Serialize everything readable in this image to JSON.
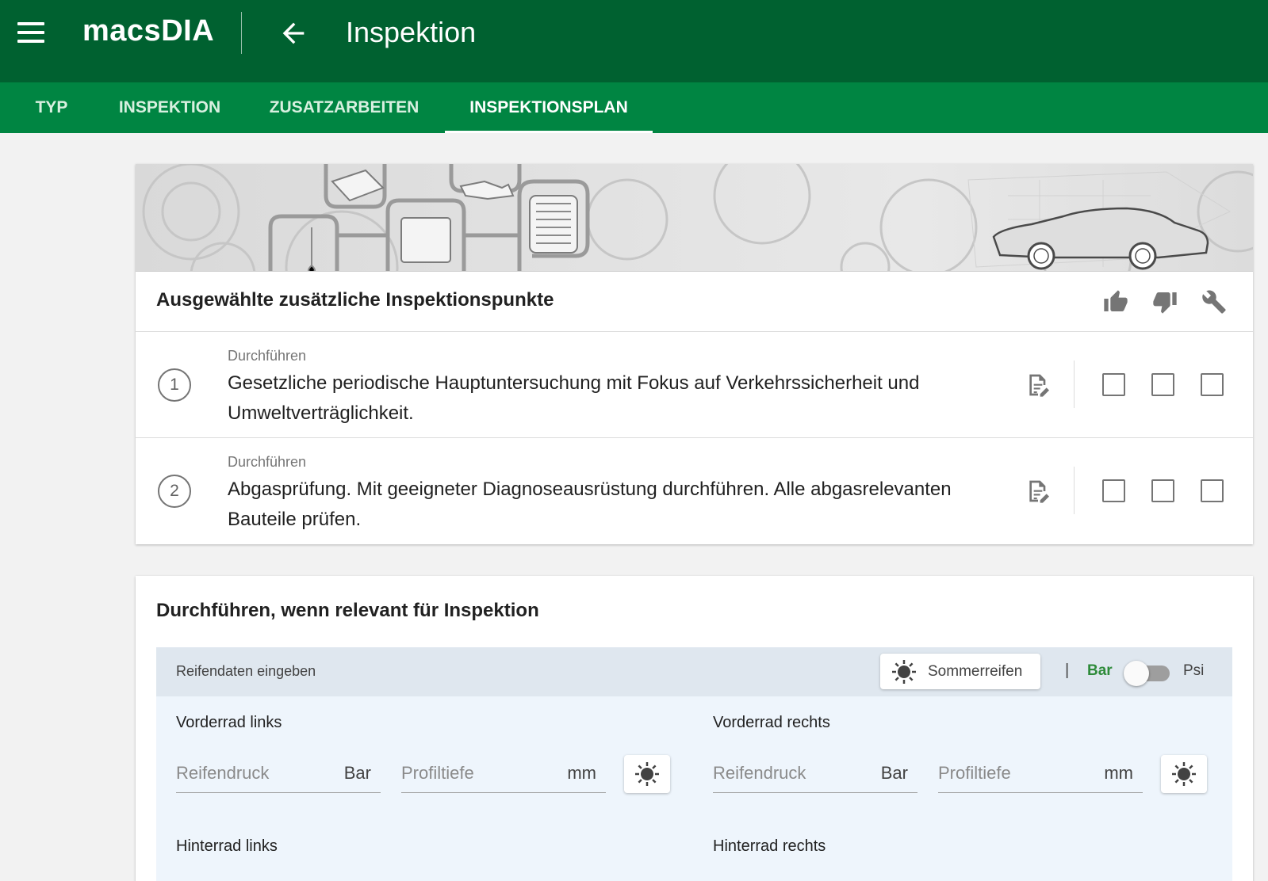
{
  "appbar": {
    "brand": "macsDIA",
    "title": "Inspektion"
  },
  "tabs": [
    {
      "label": "TYP"
    },
    {
      "label": "INSPEKTION"
    },
    {
      "label": "ZUSATZARBEITEN"
    },
    {
      "label": "INSPEKTIONSPLAN"
    }
  ],
  "active_tab": "INSPEKTIONSPLAN",
  "selected_card": {
    "title": "Ausgewählte zusätzliche Inspektionspunkte",
    "items": [
      {
        "number": "1",
        "label": "Durchführen",
        "text": "Gesetzliche periodische Hauptuntersuchung mit Fokus auf Verkehrssicherheit und Umweltverträglichkeit."
      },
      {
        "number": "2",
        "label": "Durchführen",
        "text": "Abgasprüfung. Mit geeigneter Diagnoseausrüstung durchführen. Alle abgasrelevanten Bauteile prüfen."
      }
    ]
  },
  "relevant_card": {
    "title": "Durchführen, wenn relevant für Inspektion",
    "tire_header": {
      "label": "Reifendaten eingeben",
      "season_label": "Sommerreifen",
      "separator": "|",
      "unit_bar": "Bar",
      "unit_psi": "Psi",
      "unit_toggle_psi": false
    },
    "wheels": {
      "front_left": {
        "title": "Vorderrad links",
        "pressure_placeholder": "Reifendruck",
        "pressure_unit": "Bar",
        "depth_placeholder": "Profiltiefe",
        "depth_unit": "mm"
      },
      "front_right": {
        "title": "Vorderrad rechts",
        "pressure_placeholder": "Reifendruck",
        "pressure_unit": "Bar",
        "depth_placeholder": "Profiltiefe",
        "depth_unit": "mm"
      },
      "rear_left": {
        "title": "Hinterrad links"
      },
      "rear_right": {
        "title": "Hinterrad rechts"
      }
    }
  },
  "colors": {
    "appbar": "#006130",
    "tabbar": "#008542",
    "accent_green": "#2e8b3a",
    "tire_header_bg": "#dfe7ef",
    "tire_body_bg": "#eef5fc"
  }
}
